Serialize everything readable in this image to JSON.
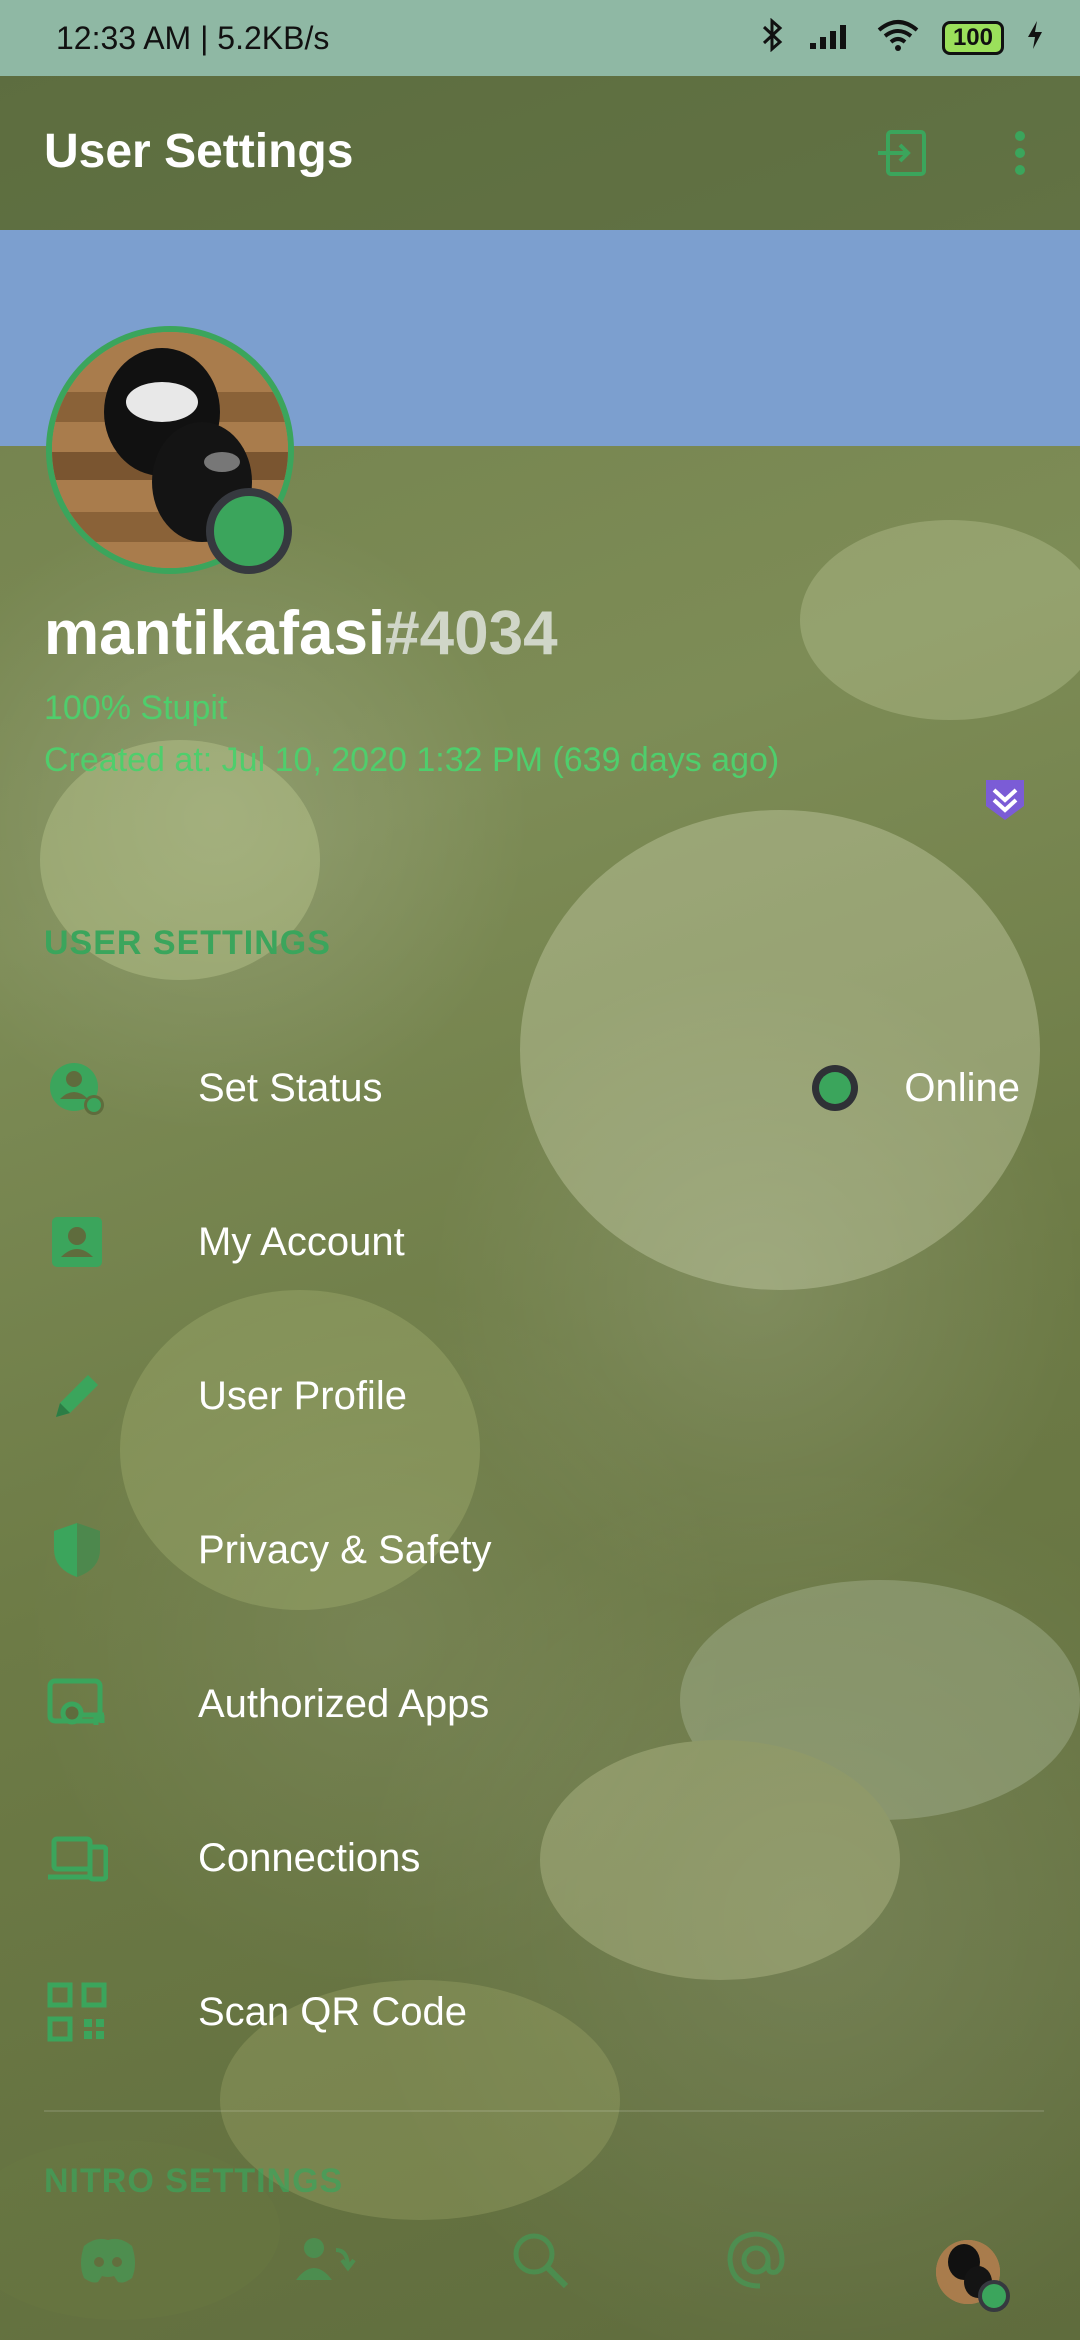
{
  "status_bar": {
    "time_speed": "12:33 AM | 5.2KB/s",
    "battery": "100"
  },
  "header": {
    "title": "User Settings",
    "logout_icon": "logout-icon",
    "more_icon": "more-vertical-icon"
  },
  "profile": {
    "username": "mantikafasi",
    "tag": "#4034",
    "about_line1": "100% Stupit",
    "about_line2": "Created at: Jul 10, 2020 1:32 PM (639 days ago)",
    "status": "online"
  },
  "sections": {
    "user_settings_title": "USER SETTINGS",
    "nitro_settings_title": "NITRO SETTINGS"
  },
  "menu": {
    "set_status": "Set Status",
    "set_status_value": "Online",
    "my_account": "My Account",
    "user_profile": "User Profile",
    "privacy_safety": "Privacy & Safety",
    "authorized_apps": "Authorized Apps",
    "connections": "Connections",
    "scan_qr": "Scan QR Code"
  },
  "colors": {
    "accent": "#3ba55c",
    "banner": "#7c9fcf",
    "statusbar": "#8fb8a4"
  },
  "bottom_nav": [
    "discord-home-icon",
    "friends-icon",
    "search-icon",
    "mentions-icon",
    "profile-avatar"
  ]
}
